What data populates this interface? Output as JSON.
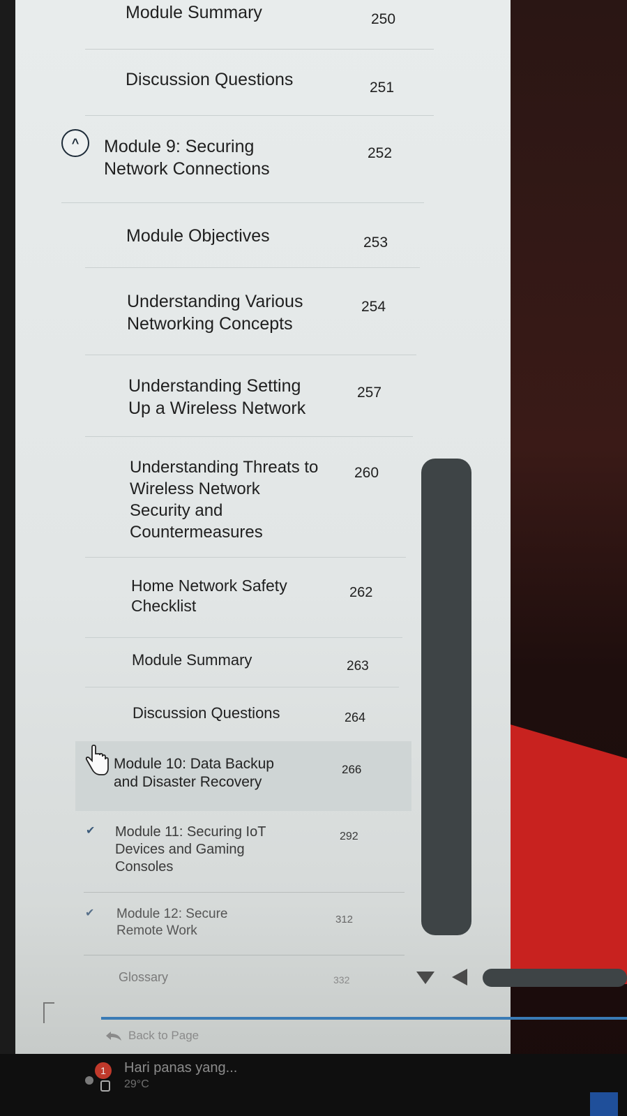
{
  "toc": {
    "items": [
      {
        "label": "Module Summary",
        "page": "250"
      },
      {
        "label": "Discussion Questions",
        "page": "251"
      },
      {
        "label": "Module 9: Securing Network Connections",
        "page": "252"
      },
      {
        "label": "Module Objectives",
        "page": "253"
      },
      {
        "label": "Understanding Various Networking Concepts",
        "page": "254"
      },
      {
        "label": "Understanding Setting Up a Wireless Network",
        "page": "257"
      },
      {
        "label": "Understanding Threats to Wireless Network Security and Countermeasures",
        "page": "260"
      },
      {
        "label": "Home Network Safety Checklist",
        "page": "262"
      },
      {
        "label": "Module Summary",
        "page": "263"
      },
      {
        "label": "Discussion Questions",
        "page": "264"
      },
      {
        "label": "Module 10: Data Backup and Disaster Recovery",
        "page": "266"
      },
      {
        "label": "Module 11: Securing IoT Devices and Gaming Consoles",
        "page": "292"
      },
      {
        "label": "Module 12: Secure Remote Work",
        "page": "312"
      },
      {
        "label": "Glossary",
        "page": "332"
      }
    ]
  },
  "footer": {
    "back_label": "Back to Page"
  },
  "taskbar": {
    "weather_text": "Hari panas yang...",
    "weather_temp": "29°C",
    "weather_badge": "1"
  },
  "icons": {
    "expanded_toggle": "chevron-up-circle-icon",
    "collapsed_toggle": "chevron-down-icon",
    "cursor": "hand-pointer-icon",
    "back": "undo-arrow-icon"
  },
  "colors": {
    "panel_bg": "#e4e8e8",
    "text": "#1f1f1f",
    "accent_blue": "#3a7bb5",
    "desktop_red": "#c8221f"
  }
}
